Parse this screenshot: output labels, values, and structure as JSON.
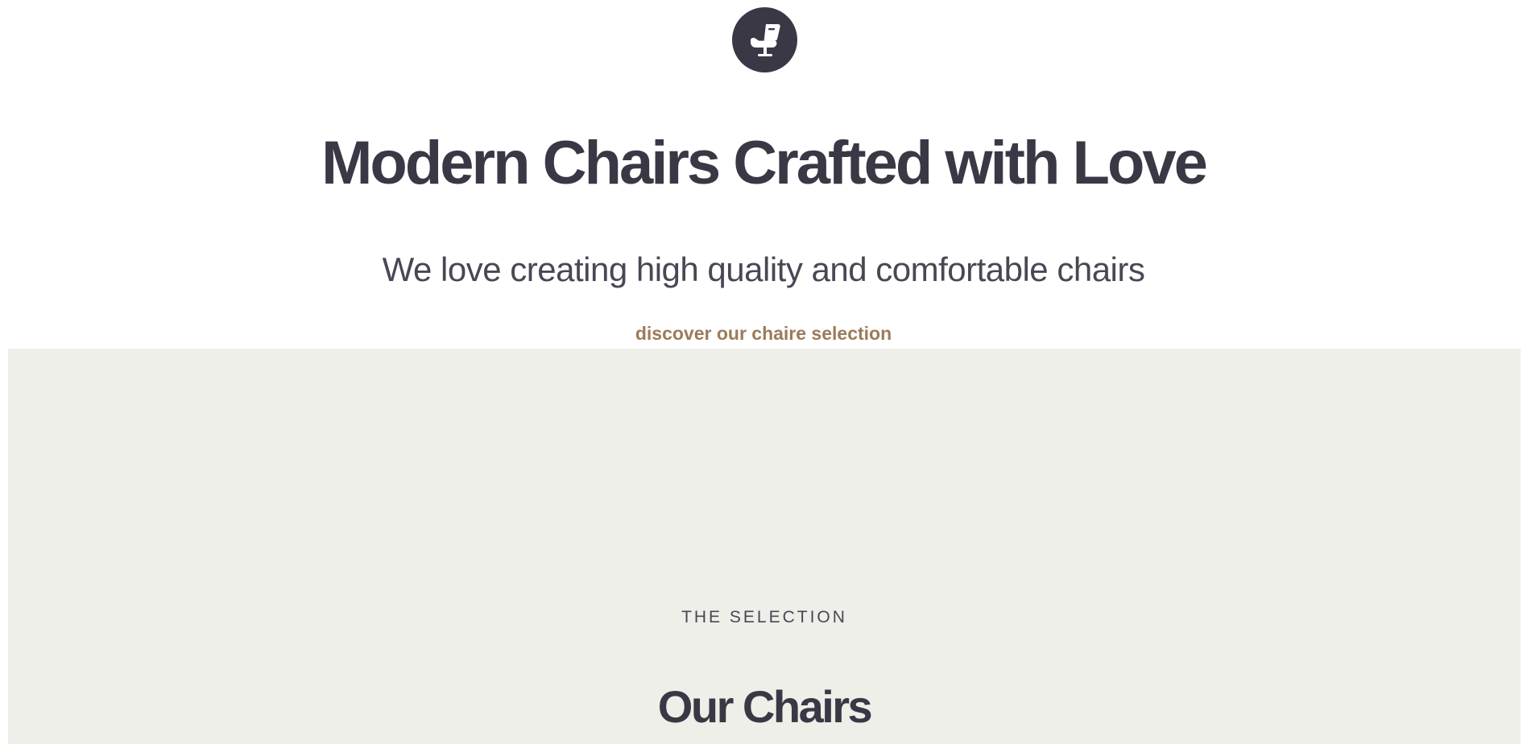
{
  "header": {
    "logo_icon": "chair-icon"
  },
  "hero": {
    "title": "Modern Chairs Crafted with Love",
    "subtitle": "We love creating high quality and comfortable chairs",
    "cta_label": "discover our chaire selection"
  },
  "selection": {
    "eyebrow": "THE SELECTION",
    "title": "Our Chairs"
  },
  "colors": {
    "primary_dark": "#3a3845",
    "accent_brown": "#9c7b5a",
    "section_background": "#edefe8",
    "page_background": "#ffffff"
  }
}
